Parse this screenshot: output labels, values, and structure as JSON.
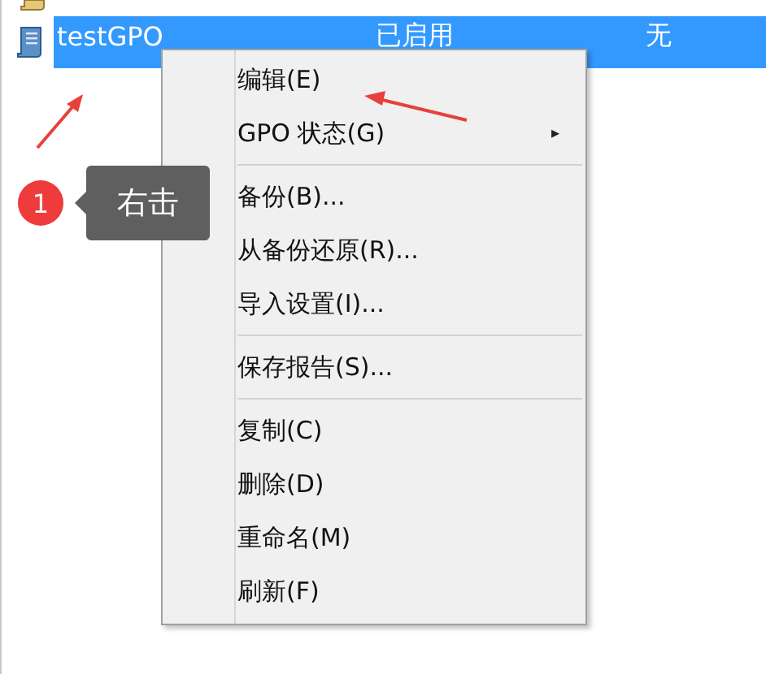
{
  "list": {
    "rows": [
      {
        "name": "testGPO",
        "status": "已启用",
        "column_3": "无",
        "selected": true
      }
    ]
  },
  "context_menu": {
    "items": [
      {
        "kind": "item",
        "label": "编辑(E)"
      },
      {
        "kind": "item",
        "label": "GPO 状态(G)",
        "arrow": "▸"
      },
      {
        "kind": "separator"
      },
      {
        "kind": "item",
        "label": "备份(B)..."
      },
      {
        "kind": "item",
        "label": "从备份还原(R)..."
      },
      {
        "kind": "item",
        "label": "导入设置(I)..."
      },
      {
        "kind": "separator"
      },
      {
        "kind": "item",
        "label": "保存报告(S)..."
      },
      {
        "kind": "separator"
      },
      {
        "kind": "item",
        "label": "复制(C)"
      },
      {
        "kind": "item",
        "label": "删除(D)"
      },
      {
        "kind": "item",
        "label": "重命名(M)"
      },
      {
        "kind": "item",
        "label": "刷新(F)"
      }
    ]
  },
  "annotation": {
    "step": "1",
    "callout": "右击"
  }
}
